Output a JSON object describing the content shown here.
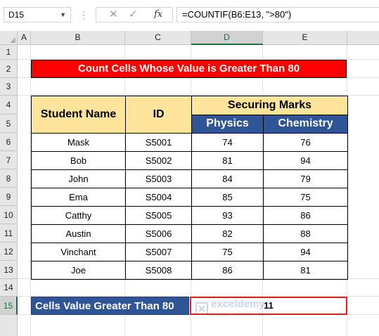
{
  "formula_bar": {
    "name_box": "D15",
    "formula": "=COUNTIF(B6:E13, \">80\")",
    "cancel_glyph": "✕",
    "confirm_glyph": "✓",
    "fx_label": "fx"
  },
  "columns": [
    "A",
    "B",
    "C",
    "D",
    "E"
  ],
  "rows": [
    "1",
    "2",
    "3",
    "4",
    "5",
    "6",
    "7",
    "8",
    "9",
    "10",
    "11",
    "12",
    "13",
    "14",
    "15"
  ],
  "title": "Count Cells Whose Value is Greater Than 80",
  "table": {
    "header_name": "Student Name",
    "header_id": "ID",
    "header_marks": "Securing Marks",
    "header_physics": "Physics",
    "header_chemistry": "Chemistry",
    "students": [
      {
        "name": "Mask",
        "id": "S5001",
        "physics": "74",
        "chemistry": "76"
      },
      {
        "name": "Bob",
        "id": "S5002",
        "physics": "81",
        "chemistry": "94"
      },
      {
        "name": "John",
        "id": "S5003",
        "physics": "84",
        "chemistry": "79"
      },
      {
        "name": "Ema",
        "id": "S5004",
        "physics": "85",
        "chemistry": "75"
      },
      {
        "name": "Catthy",
        "id": "S5005",
        "physics": "93",
        "chemistry": "86"
      },
      {
        "name": "Austin",
        "id": "S5006",
        "physics": "82",
        "chemistry": "88"
      },
      {
        "name": "Vinchant",
        "id": "S5007",
        "physics": "75",
        "chemistry": "94"
      },
      {
        "name": "Joe",
        "id": "S5008",
        "physics": "86",
        "chemistry": "81"
      }
    ]
  },
  "summary": {
    "label": "Cells Value Greater Than 80",
    "value": "11"
  },
  "watermark": {
    "name": "exceldemy",
    "tagline": "EXCEL · DATA · BI"
  },
  "colors": {
    "title_bg": "#ff0000",
    "header_bg": "#ffe59b",
    "subheader_bg": "#2f5597",
    "selection_border": "#e0201a",
    "selected_header": "#1e6e42"
  }
}
